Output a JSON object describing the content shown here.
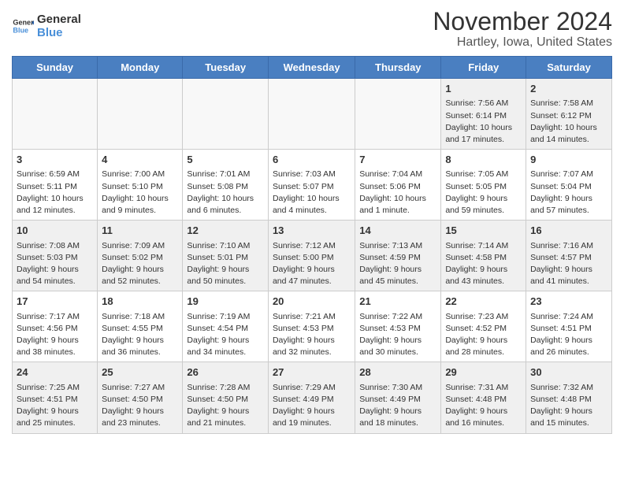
{
  "header": {
    "logo_line1": "General",
    "logo_line2": "Blue",
    "month": "November 2024",
    "location": "Hartley, Iowa, United States"
  },
  "days_of_week": [
    "Sunday",
    "Monday",
    "Tuesday",
    "Wednesday",
    "Thursday",
    "Friday",
    "Saturday"
  ],
  "weeks": [
    [
      {
        "day": "",
        "info": ""
      },
      {
        "day": "",
        "info": ""
      },
      {
        "day": "",
        "info": ""
      },
      {
        "day": "",
        "info": ""
      },
      {
        "day": "",
        "info": ""
      },
      {
        "day": "1",
        "info": "Sunrise: 7:56 AM\nSunset: 6:14 PM\nDaylight: 10 hours\nand 17 minutes."
      },
      {
        "day": "2",
        "info": "Sunrise: 7:58 AM\nSunset: 6:12 PM\nDaylight: 10 hours\nand 14 minutes."
      }
    ],
    [
      {
        "day": "3",
        "info": "Sunrise: 6:59 AM\nSunset: 5:11 PM\nDaylight: 10 hours\nand 12 minutes."
      },
      {
        "day": "4",
        "info": "Sunrise: 7:00 AM\nSunset: 5:10 PM\nDaylight: 10 hours\nand 9 minutes."
      },
      {
        "day": "5",
        "info": "Sunrise: 7:01 AM\nSunset: 5:08 PM\nDaylight: 10 hours\nand 6 minutes."
      },
      {
        "day": "6",
        "info": "Sunrise: 7:03 AM\nSunset: 5:07 PM\nDaylight: 10 hours\nand 4 minutes."
      },
      {
        "day": "7",
        "info": "Sunrise: 7:04 AM\nSunset: 5:06 PM\nDaylight: 10 hours\nand 1 minute."
      },
      {
        "day": "8",
        "info": "Sunrise: 7:05 AM\nSunset: 5:05 PM\nDaylight: 9 hours\nand 59 minutes."
      },
      {
        "day": "9",
        "info": "Sunrise: 7:07 AM\nSunset: 5:04 PM\nDaylight: 9 hours\nand 57 minutes."
      }
    ],
    [
      {
        "day": "10",
        "info": "Sunrise: 7:08 AM\nSunset: 5:03 PM\nDaylight: 9 hours\nand 54 minutes."
      },
      {
        "day": "11",
        "info": "Sunrise: 7:09 AM\nSunset: 5:02 PM\nDaylight: 9 hours\nand 52 minutes."
      },
      {
        "day": "12",
        "info": "Sunrise: 7:10 AM\nSunset: 5:01 PM\nDaylight: 9 hours\nand 50 minutes."
      },
      {
        "day": "13",
        "info": "Sunrise: 7:12 AM\nSunset: 5:00 PM\nDaylight: 9 hours\nand 47 minutes."
      },
      {
        "day": "14",
        "info": "Sunrise: 7:13 AM\nSunset: 4:59 PM\nDaylight: 9 hours\nand 45 minutes."
      },
      {
        "day": "15",
        "info": "Sunrise: 7:14 AM\nSunset: 4:58 PM\nDaylight: 9 hours\nand 43 minutes."
      },
      {
        "day": "16",
        "info": "Sunrise: 7:16 AM\nSunset: 4:57 PM\nDaylight: 9 hours\nand 41 minutes."
      }
    ],
    [
      {
        "day": "17",
        "info": "Sunrise: 7:17 AM\nSunset: 4:56 PM\nDaylight: 9 hours\nand 38 minutes."
      },
      {
        "day": "18",
        "info": "Sunrise: 7:18 AM\nSunset: 4:55 PM\nDaylight: 9 hours\nand 36 minutes."
      },
      {
        "day": "19",
        "info": "Sunrise: 7:19 AM\nSunset: 4:54 PM\nDaylight: 9 hours\nand 34 minutes."
      },
      {
        "day": "20",
        "info": "Sunrise: 7:21 AM\nSunset: 4:53 PM\nDaylight: 9 hours\nand 32 minutes."
      },
      {
        "day": "21",
        "info": "Sunrise: 7:22 AM\nSunset: 4:53 PM\nDaylight: 9 hours\nand 30 minutes."
      },
      {
        "day": "22",
        "info": "Sunrise: 7:23 AM\nSunset: 4:52 PM\nDaylight: 9 hours\nand 28 minutes."
      },
      {
        "day": "23",
        "info": "Sunrise: 7:24 AM\nSunset: 4:51 PM\nDaylight: 9 hours\nand 26 minutes."
      }
    ],
    [
      {
        "day": "24",
        "info": "Sunrise: 7:25 AM\nSunset: 4:51 PM\nDaylight: 9 hours\nand 25 minutes."
      },
      {
        "day": "25",
        "info": "Sunrise: 7:27 AM\nSunset: 4:50 PM\nDaylight: 9 hours\nand 23 minutes."
      },
      {
        "day": "26",
        "info": "Sunrise: 7:28 AM\nSunset: 4:50 PM\nDaylight: 9 hours\nand 21 minutes."
      },
      {
        "day": "27",
        "info": "Sunrise: 7:29 AM\nSunset: 4:49 PM\nDaylight: 9 hours\nand 19 minutes."
      },
      {
        "day": "28",
        "info": "Sunrise: 7:30 AM\nSunset: 4:49 PM\nDaylight: 9 hours\nand 18 minutes."
      },
      {
        "day": "29",
        "info": "Sunrise: 7:31 AM\nSunset: 4:48 PM\nDaylight: 9 hours\nand 16 minutes."
      },
      {
        "day": "30",
        "info": "Sunrise: 7:32 AM\nSunset: 4:48 PM\nDaylight: 9 hours\nand 15 minutes."
      }
    ]
  ]
}
